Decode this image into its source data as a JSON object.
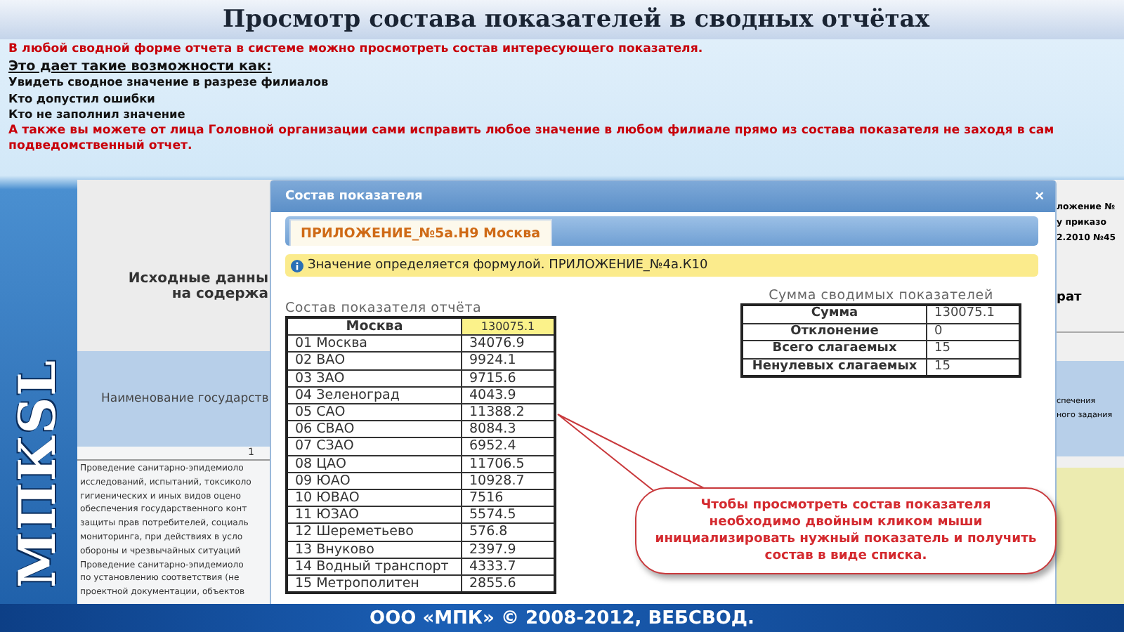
{
  "slide": {
    "title": "Просмотр состава показателей в сводных отчётах",
    "logo_text": "МПКSL",
    "lines": [
      {
        "kind": "lead",
        "text": "В любой сводной форме отчета в системе можно просмотреть состав интересующего показателя."
      },
      {
        "kind": "heading",
        "text": "Это дает такие возможности как:"
      },
      {
        "kind": "item",
        "text": "Увидеть сводное значение в разрезе филиалов"
      },
      {
        "kind": "item",
        "text": "Кто допустил ошибки"
      },
      {
        "kind": "item",
        "text": "Кто не заполнил значение"
      },
      {
        "kind": "lead",
        "text": "А также вы можете от лица Головной организации сами исправить любое значение в любом филиале прямо из состава показателя не заходя в сам подведомственный отчет."
      }
    ],
    "footer": "ООО «МПК» © 2008-2012, ВЕБСВОД."
  },
  "report": {
    "header": [
      "Исходные данны",
      "на содержа"
    ],
    "column_header": "Наименование государств",
    "column_number": "1",
    "body": [
      "Проведение санитарно-эпидемиоло",
      "исследований, испытаний, токсиколо",
      "гигиенических и иных видов оцено",
      "обеспечения государственного конт",
      "защиты прав потребителей, социаль",
      "мониторинга, при действиях в усло",
      "обороны и чрезвычайных ситуаций",
      "Проведение санитарно-эпидемиоло",
      "по установлению соответствия (не",
      "проектной документации, объектов"
    ],
    "right_header": [
      "ложение №",
      "у приказо",
      "2.2010 №45"
    ],
    "right_label": "рат",
    "right_cell": [
      "спечения",
      "ного задания"
    ]
  },
  "dialog": {
    "title": "Состав показателя",
    "close": "×",
    "tabs": [
      {
        "label": "ПРИЛОЖЕНИЕ_№5а.Н9 Москва",
        "selected": true
      }
    ],
    "info": "Значение определяется формулой. ПРИЛОЖЕНИЕ_№4а.К10",
    "composition": {
      "title": "Состав показателя отчёта",
      "total_label": "Москва",
      "total_value": "130075.1",
      "rows": [
        {
          "name": "01 Москва",
          "value": "34076.9"
        },
        {
          "name": "02 ВАО",
          "value": "9924.1"
        },
        {
          "name": "03 ЗАО",
          "value": "9715.6"
        },
        {
          "name": "04 Зеленоград",
          "value": "4043.9"
        },
        {
          "name": "05 САО",
          "value": "11388.2"
        },
        {
          "name": "06 СВАО",
          "value": "8084.3"
        },
        {
          "name": "07 СЗАО",
          "value": "6952.4"
        },
        {
          "name": "08 ЦАО",
          "value": "11706.5"
        },
        {
          "name": "09 ЮАО",
          "value": "10928.7"
        },
        {
          "name": "10 ЮВАО",
          "value": "7516"
        },
        {
          "name": "11 ЮЗАО",
          "value": "5574.5"
        },
        {
          "name": "12 Шереметьево",
          "value": "576.8"
        },
        {
          "name": "13 Внуково",
          "value": "2397.9"
        },
        {
          "name": "14 Водный транспорт",
          "value": "4333.7"
        },
        {
          "name": "15 Метрополитен",
          "value": "2855.6"
        }
      ]
    },
    "summary": {
      "title": "Сумма сводимых показателей",
      "rows": [
        {
          "label": "Сумма",
          "value": "130075.1"
        },
        {
          "label": "Отклонение",
          "value": "0"
        },
        {
          "label": "Всего слагаемых",
          "value": "15"
        },
        {
          "label": "Ненулевых слагаемых",
          "value": "15"
        }
      ]
    },
    "callout": "Чтобы просмотреть состав показателя необходимо двойным кликом мыши инициализировать нужный показатель и получить состав в виде списка."
  }
}
